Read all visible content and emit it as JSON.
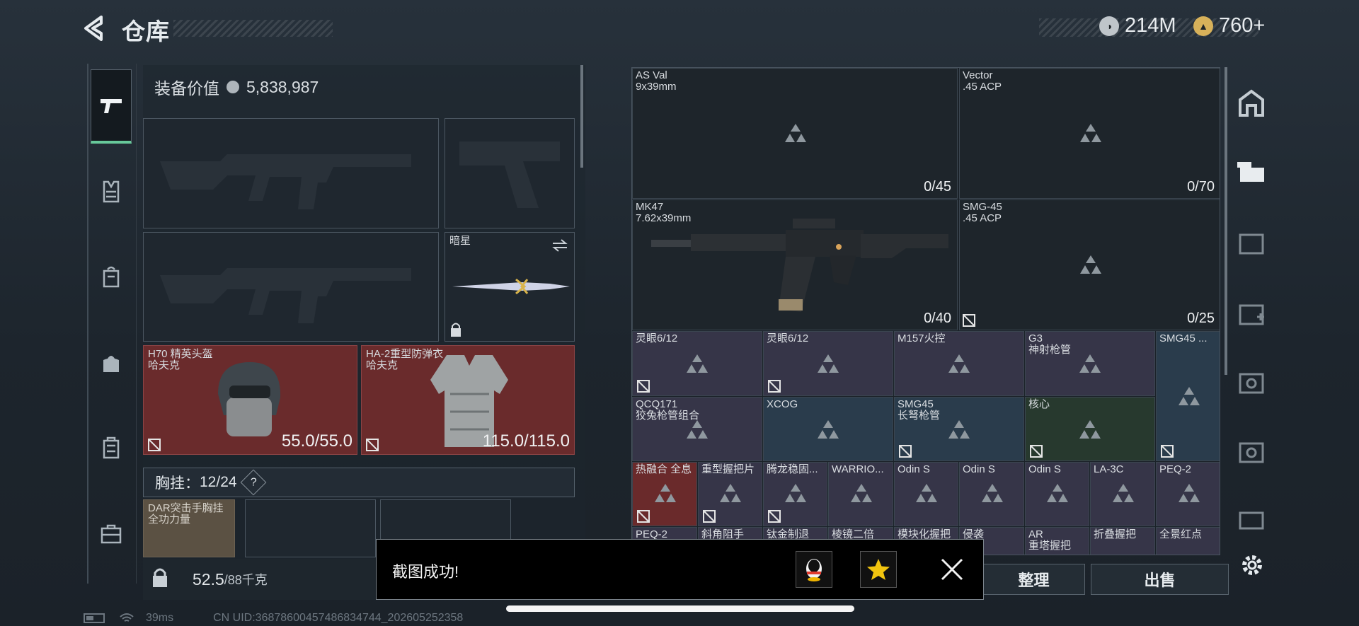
{
  "header": {
    "title": "仓库",
    "silver": "214M",
    "gold": "760+"
  },
  "nav": {
    "items": [
      "pistol-icon",
      "vest-icon",
      "backpack-icon",
      "bag-icon",
      "case-icon",
      "briefcase-icon"
    ]
  },
  "equipment": {
    "value_label": "装备价值",
    "value": "5,838,987",
    "melee_label": "暗星",
    "helmet": {
      "name": "H70 精英头盔",
      "brand": "哈夫克",
      "durability": "55.0/55.0"
    },
    "armor": {
      "name": "HA-2重型防弹衣",
      "brand": "哈夫克",
      "durability": "115.0/115.0"
    },
    "chest_label": "胸挂：",
    "chest_count": "12/24",
    "chest_help": "?",
    "chest_item": "DAR突击手胸挂\n全功力量",
    "weight_value": "52.5",
    "weight_cap": "/88千克"
  },
  "stash": {
    "weapons": [
      {
        "name": "AS Val\n9x39mm",
        "count": "0/45"
      },
      {
        "name": "Vector\n.45 ACP",
        "count": "0/70"
      },
      {
        "name": "MK47\n7.62x39mm",
        "count": "0/40"
      },
      {
        "name": "SMG-45\n.45 ACP",
        "count": "0/25"
      }
    ],
    "row1": [
      "灵眼6/12",
      "灵眼6/12",
      "M157火控",
      "G3\n神射枪管",
      "SMG45 ..."
    ],
    "row2": [
      "QCQ171\n狡兔枪管组合",
      "XCOG",
      "SMG45\n长弩枪管",
      "核心"
    ],
    "row3": [
      "热融合 全息",
      "重型握把片",
      "腾龙稳固...",
      "WARRIO...",
      "Odin S",
      "Odin S",
      "Odin S",
      "LA-3C",
      "PEQ-2"
    ],
    "row4": [
      "PEQ-2",
      "斜角阻手",
      "钛金制退",
      "棱镜二倍",
      "模块化握把",
      "侵袭",
      "AR\n重塔握把",
      "折叠握把",
      "全景红点"
    ]
  },
  "buttons": {
    "sort": "整理",
    "sell": "出售"
  },
  "toast": {
    "message": "截图成功!"
  },
  "status": {
    "ping": "39ms",
    "uid": "CN UID:3687860045748683474​4_202605252358"
  }
}
